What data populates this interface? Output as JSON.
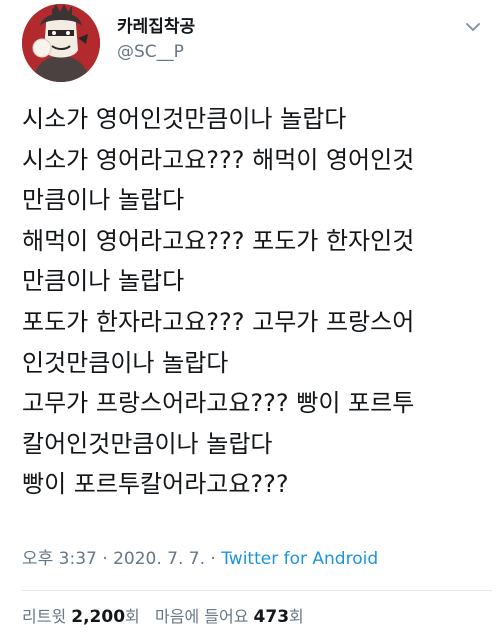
{
  "user": {
    "display_name": "카레집착공",
    "handle": "@SC__P"
  },
  "tweet": {
    "lines": [
      "시소가 영어인것만큼이나 놀랍다",
      "시소가 영어라고요??? 해먹이 영어인것",
      "만큼이나 놀랍다",
      "해먹이 영어라고요??? 포도가 한자인것",
      "만큼이나 놀랍다",
      "포도가 한자라고요??? 고무가 프랑스어",
      "인것만큼이나 놀랍다",
      "고무가 프랑스어라고요??? 빵이 포르투",
      "칼어인것만큼이나 놀랍다",
      "빵이 포르투칼어라고요???"
    ],
    "time": "오후 3:37",
    "separator1": " · ",
    "date": "2020. 7. 7.",
    "separator2": " · ",
    "source": "Twitter for Android"
  },
  "stats": {
    "retweets_label": "리트윗",
    "retweets_count": "2,200",
    "retweets_unit": "회",
    "likes_label": "마음에 들어요",
    "likes_count": "473",
    "likes_unit": "회"
  },
  "colors": {
    "link": "#1b95e0",
    "secondary_text": "#657786",
    "primary_text": "#14171a",
    "avatar_bg": "#a8282c"
  },
  "icons": {
    "avatar": "profile-avatar-illustration",
    "menu": "chevron-down-icon"
  }
}
